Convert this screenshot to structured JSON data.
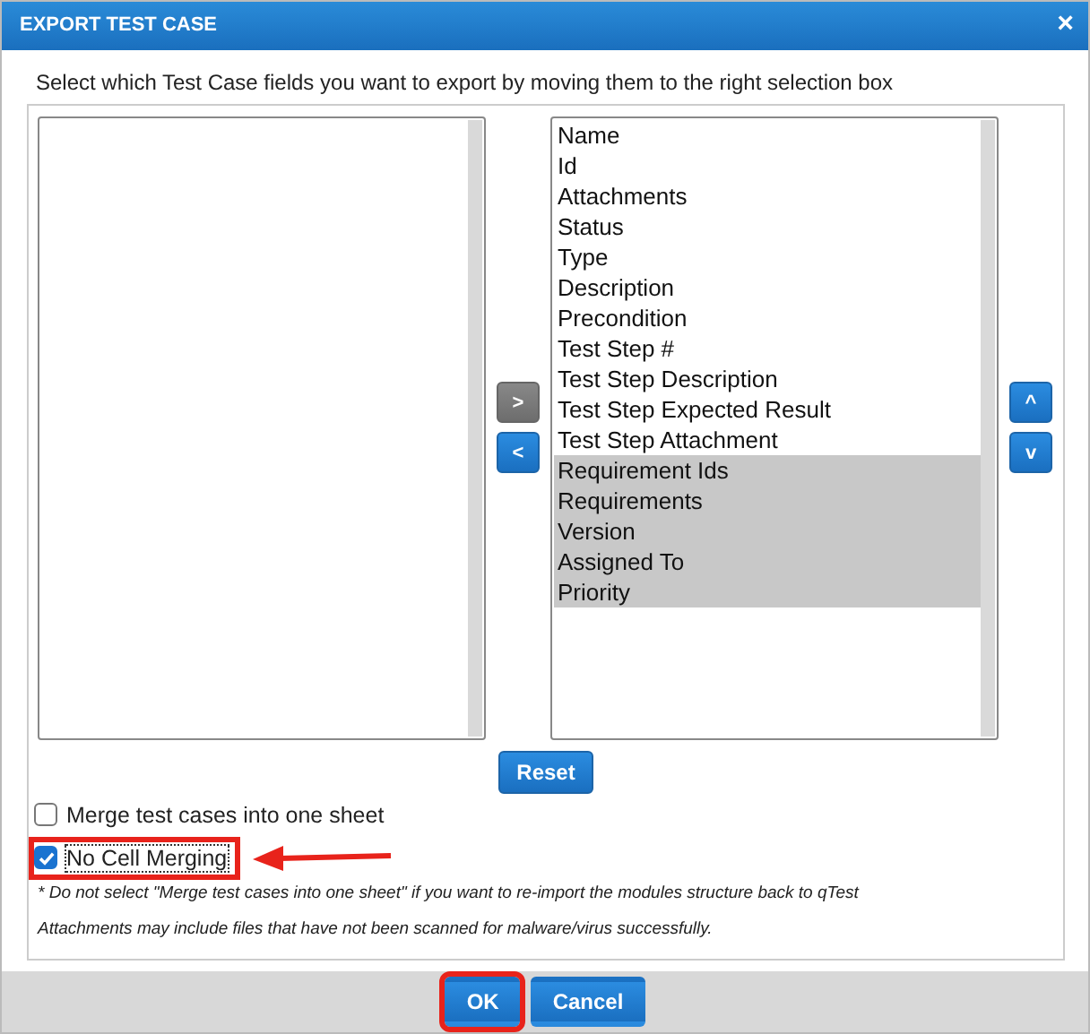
{
  "window": {
    "title": "EXPORT TEST CASE",
    "close": "×"
  },
  "instruction": "Select which Test Case fields you want to export by moving them to the right selection box",
  "move_buttons": [
    {
      "label": ">",
      "disabled": true
    },
    {
      "label": "<",
      "disabled": false
    }
  ],
  "selected_fields": [
    {
      "label": "Name",
      "selected": false
    },
    {
      "label": "Id",
      "selected": false
    },
    {
      "label": "Attachments",
      "selected": false
    },
    {
      "label": "Status",
      "selected": false
    },
    {
      "label": "Type",
      "selected": false
    },
    {
      "label": "Description",
      "selected": false
    },
    {
      "label": "Precondition",
      "selected": false
    },
    {
      "label": "Test Step #",
      "selected": false
    },
    {
      "label": "Test Step Description",
      "selected": false
    },
    {
      "label": "Test Step Expected Result",
      "selected": false
    },
    {
      "label": "Test Step Attachment",
      "selected": false
    },
    {
      "label": "Requirement Ids",
      "selected": true
    },
    {
      "label": "Requirements",
      "selected": true
    },
    {
      "label": "Version",
      "selected": true
    },
    {
      "label": "Assigned To",
      "selected": true
    },
    {
      "label": "Priority",
      "selected": true
    }
  ],
  "order_buttons": [
    {
      "label": "^"
    },
    {
      "label": "v"
    }
  ],
  "reset_button": "Reset",
  "options": [
    {
      "label": "Merge test cases into one sheet",
      "checked": false,
      "highlighted": false,
      "arrow": false
    },
    {
      "label": "No Cell Merging",
      "checked": true,
      "highlighted": true,
      "arrow": true
    }
  ],
  "notes": [
    "* Do not select \"Merge test cases into one sheet\" if you want to re-import the modules structure back to qTest",
    "Attachments may include files that have not been scanned for malware/virus successfully."
  ],
  "footer_buttons": [
    {
      "label": "OK",
      "highlighted": true
    },
    {
      "label": "Cancel",
      "highlighted": false
    }
  ]
}
